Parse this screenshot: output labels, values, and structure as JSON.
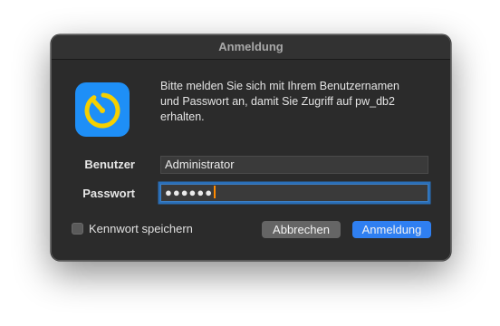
{
  "window": {
    "title": "Anmeldung"
  },
  "app_icon": {
    "icon": "timer-icon",
    "background": "#1e8ff7",
    "ring_color": "#f5d000"
  },
  "message": {
    "lines": [
      "Bitte melden Sie sich mit Ihrem Benutzernamen",
      "und Passwort an, damit Sie Zugriff auf pw_db2",
      "erhalten."
    ]
  },
  "form": {
    "user_label": "Benutzer",
    "user_value": "Administrator",
    "password_label": "Passwort",
    "password_masked": "●●●●●●"
  },
  "remember": {
    "label": "Kennwort speichern",
    "checked": false
  },
  "buttons": {
    "cancel": "Abbrechen",
    "ok": "Anmeldung"
  },
  "colors": {
    "dialog_bg": "#2b2b2b",
    "accent": "#2f7ff1",
    "focus_ring": "#2a6fb8",
    "caret": "#ff8a00"
  }
}
